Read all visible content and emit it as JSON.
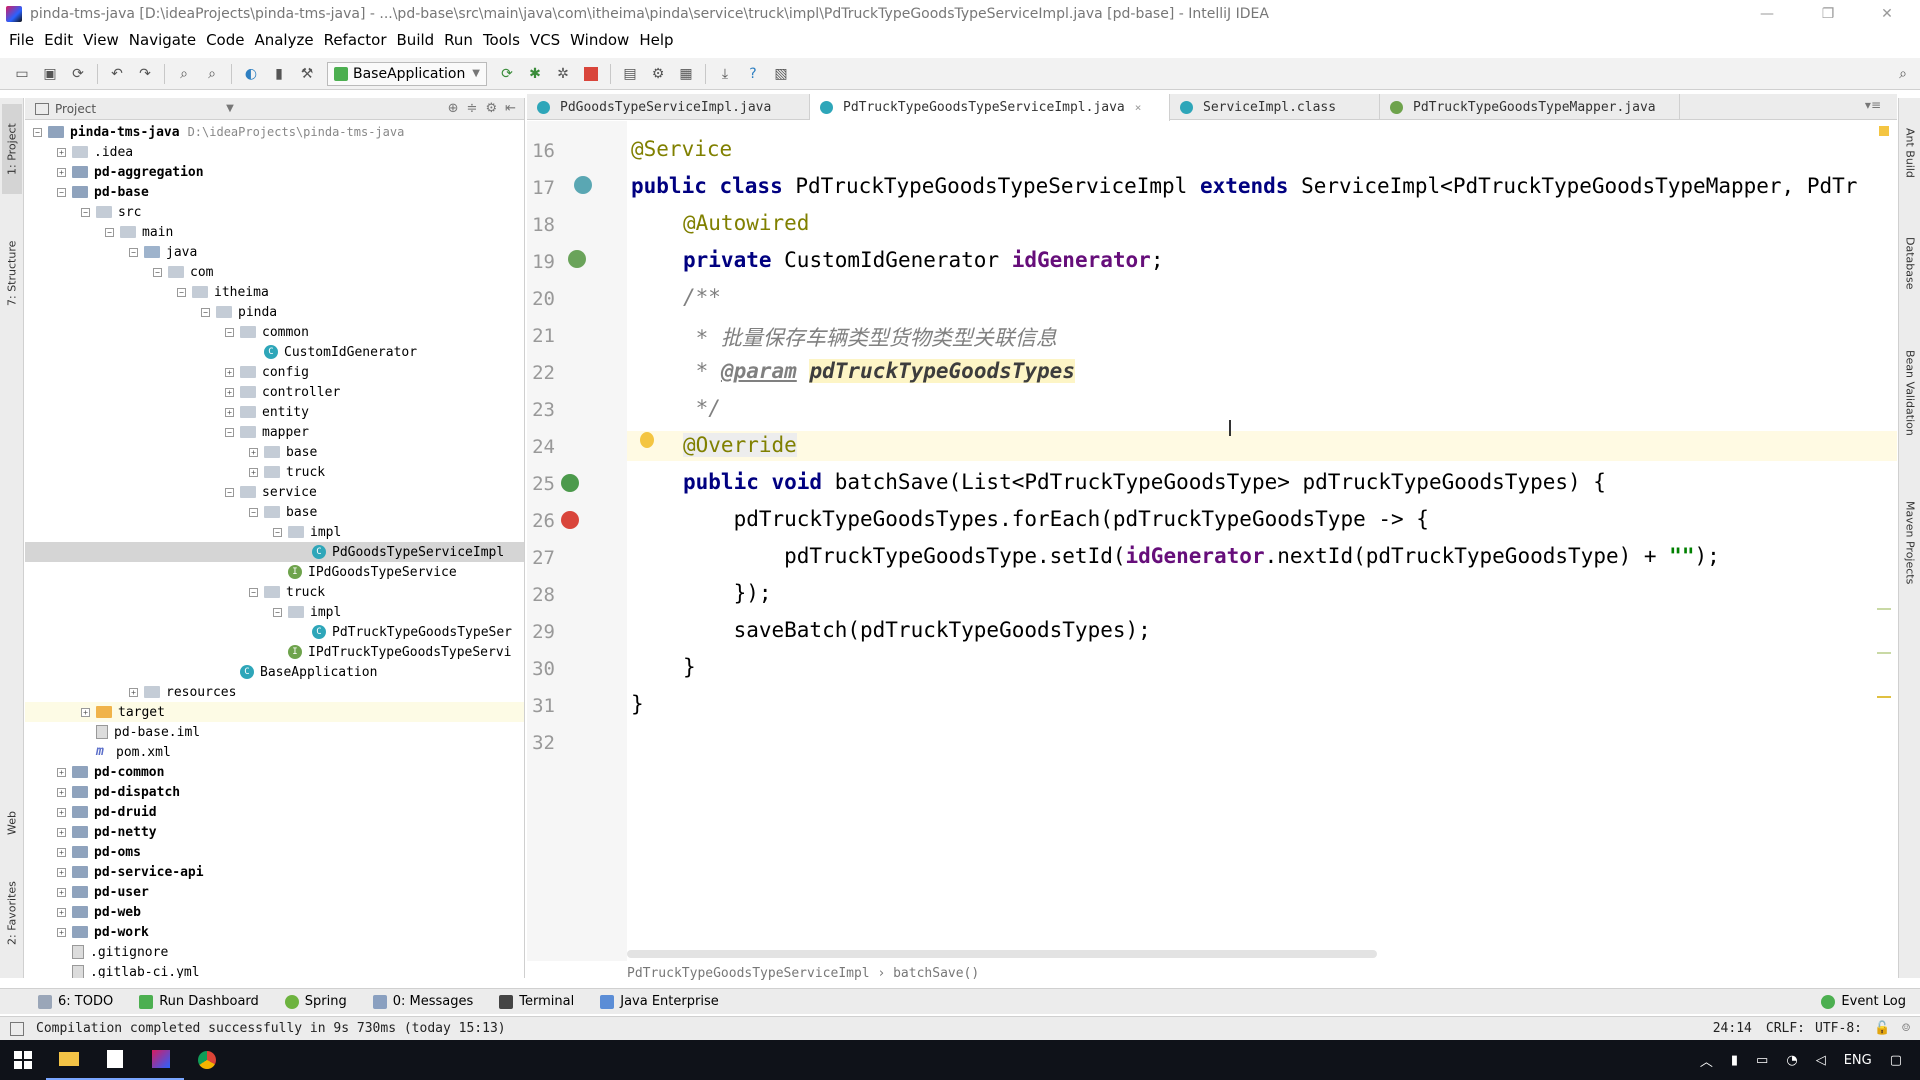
{
  "window": {
    "title": "pinda-tms-java [D:\\ideaProjects\\pinda-tms-java] - ...\\pd-base\\src\\main\\java\\com\\itheima\\pinda\\service\\truck\\impl\\PdTruckTypeGoodsTypeServiceImpl.java [pd-base] - IntelliJ IDEA",
    "minimize": "—",
    "maximize": "❐",
    "close": "✕"
  },
  "menu": [
    "File",
    "Edit",
    "View",
    "Navigate",
    "Code",
    "Analyze",
    "Refactor",
    "Build",
    "Run",
    "Tools",
    "VCS",
    "Window",
    "Help"
  ],
  "toolbar": {
    "run_config": "BaseApplication"
  },
  "left_strip": {
    "project": "1: Project",
    "structure": "7: Structure",
    "web": "Web",
    "favorites": "2: Favorites"
  },
  "right_strip": {
    "ant": "Ant Build",
    "database": "Database",
    "bean": "Bean Validation",
    "maven": "Maven Projects"
  },
  "project_panel": {
    "title": "Project",
    "tree": [
      {
        "label": "pinda-tms-java",
        "path": "D:\\ideaProjects\\pinda-tms-java",
        "bold": true
      },
      {
        "label": ".idea"
      },
      {
        "label": "pd-aggregation",
        "bold": true
      },
      {
        "label": "pd-base",
        "bold": true
      },
      {
        "label": "src"
      },
      {
        "label": "main"
      },
      {
        "label": "java"
      },
      {
        "label": "com"
      },
      {
        "label": "itheima"
      },
      {
        "label": "pinda"
      },
      {
        "label": "common"
      },
      {
        "label": "CustomIdGenerator"
      },
      {
        "label": "config"
      },
      {
        "label": "controller"
      },
      {
        "label": "entity"
      },
      {
        "label": "mapper"
      },
      {
        "label": "base"
      },
      {
        "label": "truck"
      },
      {
        "label": "service"
      },
      {
        "label": "base"
      },
      {
        "label": "impl"
      },
      {
        "label": "PdGoodsTypeServiceImpl"
      },
      {
        "label": "IPdGoodsTypeService"
      },
      {
        "label": "truck"
      },
      {
        "label": "impl"
      },
      {
        "label": "PdTruckTypeGoodsTypeSer"
      },
      {
        "label": "IPdTruckTypeGoodsTypeServi"
      },
      {
        "label": "BaseApplication"
      },
      {
        "label": "resources"
      },
      {
        "label": "target"
      },
      {
        "label": "pd-base.iml"
      },
      {
        "label": "pom.xml"
      },
      {
        "label": "pd-common",
        "bold": true
      },
      {
        "label": "pd-dispatch",
        "bold": true
      },
      {
        "label": "pd-druid",
        "bold": true
      },
      {
        "label": "pd-netty",
        "bold": true
      },
      {
        "label": "pd-oms",
        "bold": true
      },
      {
        "label": "pd-service-api",
        "bold": true
      },
      {
        "label": "pd-user",
        "bold": true
      },
      {
        "label": "pd-web",
        "bold": true
      },
      {
        "label": "pd-work",
        "bold": true
      },
      {
        "label": ".gitignore"
      },
      {
        "label": ".gitlab-ci.yml"
      }
    ]
  },
  "editor_tabs": [
    {
      "label": "PdGoodsTypeServiceImpl.java"
    },
    {
      "label": "PdTruckTypeGoodsTypeServiceImpl.java",
      "close": "×"
    },
    {
      "label": "ServiceImpl.class"
    },
    {
      "label": "PdTruckTypeGoodsTypeMapper.java"
    }
  ],
  "editor": {
    "line_numbers": [
      "16",
      "17",
      "18",
      "19",
      "20",
      "21",
      "22",
      "23",
      "24",
      "25",
      "26",
      "27",
      "28",
      "29",
      "30",
      "31",
      "32"
    ],
    "code": {
      "l16_ann": "@Service",
      "l17_kw1": "public class ",
      "l17_name": "PdTruckTypeGoodsTypeServiceImpl ",
      "l17_kw2": "extends ",
      "l17_rest": "ServiceImpl<PdTruckTypeGoodsTypeMapper, PdTr",
      "l18_ann": "@Autowired",
      "l19_kw": "private ",
      "l19_type": "CustomIdGenerator ",
      "l19_fld": "idGenerator",
      "l19_end": ";",
      "l20_doc": "/**",
      "l21_doc": " * 批量保存车辆类型货物类型关联信息",
      "l22_star": " * ",
      "l22_tag": "@param",
      "l22_sp": " ",
      "l22_param": "pdTruckTypeGoodsTypes",
      "l23_doc": " */",
      "l24_ann": "@Override",
      "l25_kw": "public void ",
      "l25_rest": "batchSave(List<PdTruckTypeGoodsType> pdTruckTypeGoodsTypes) {",
      "l26": "    pdTruckTypeGoodsTypes.forEach(pdTruckTypeGoodsType -> {",
      "l27_a": "        pdTruckTypeGoodsType.setId(",
      "l27_fld": "idGenerator",
      "l27_b": ".nextId(pdTruckTypeGoodsType) + ",
      "l27_str": "\"\"",
      "l27_c": ");",
      "l28": "    });",
      "l29": "    saveBatch(pdTruckTypeGoodsTypes);",
      "l30": "}",
      "l31": "}"
    },
    "breadcrumb": "PdTruckTypeGoodsTypeServiceImpl  ›  batchSave()"
  },
  "bottom_tools": [
    "6: TODO",
    "Run Dashboard",
    "Spring",
    "0: Messages",
    "Terminal",
    "Java Enterprise"
  ],
  "event_log": "Event Log",
  "status": {
    "message": "Compilation completed successfully in 9s 730ms (today 15:13)",
    "position": "24:14",
    "line_sep": "CRLF:",
    "encoding": "UTF-8:"
  },
  "taskbar": {
    "lang": "ENG"
  },
  "colors": {
    "keyword": "#000080",
    "annotation": "#808000",
    "comment": "#808080",
    "field": "#660e7a",
    "string": "#008000"
  }
}
